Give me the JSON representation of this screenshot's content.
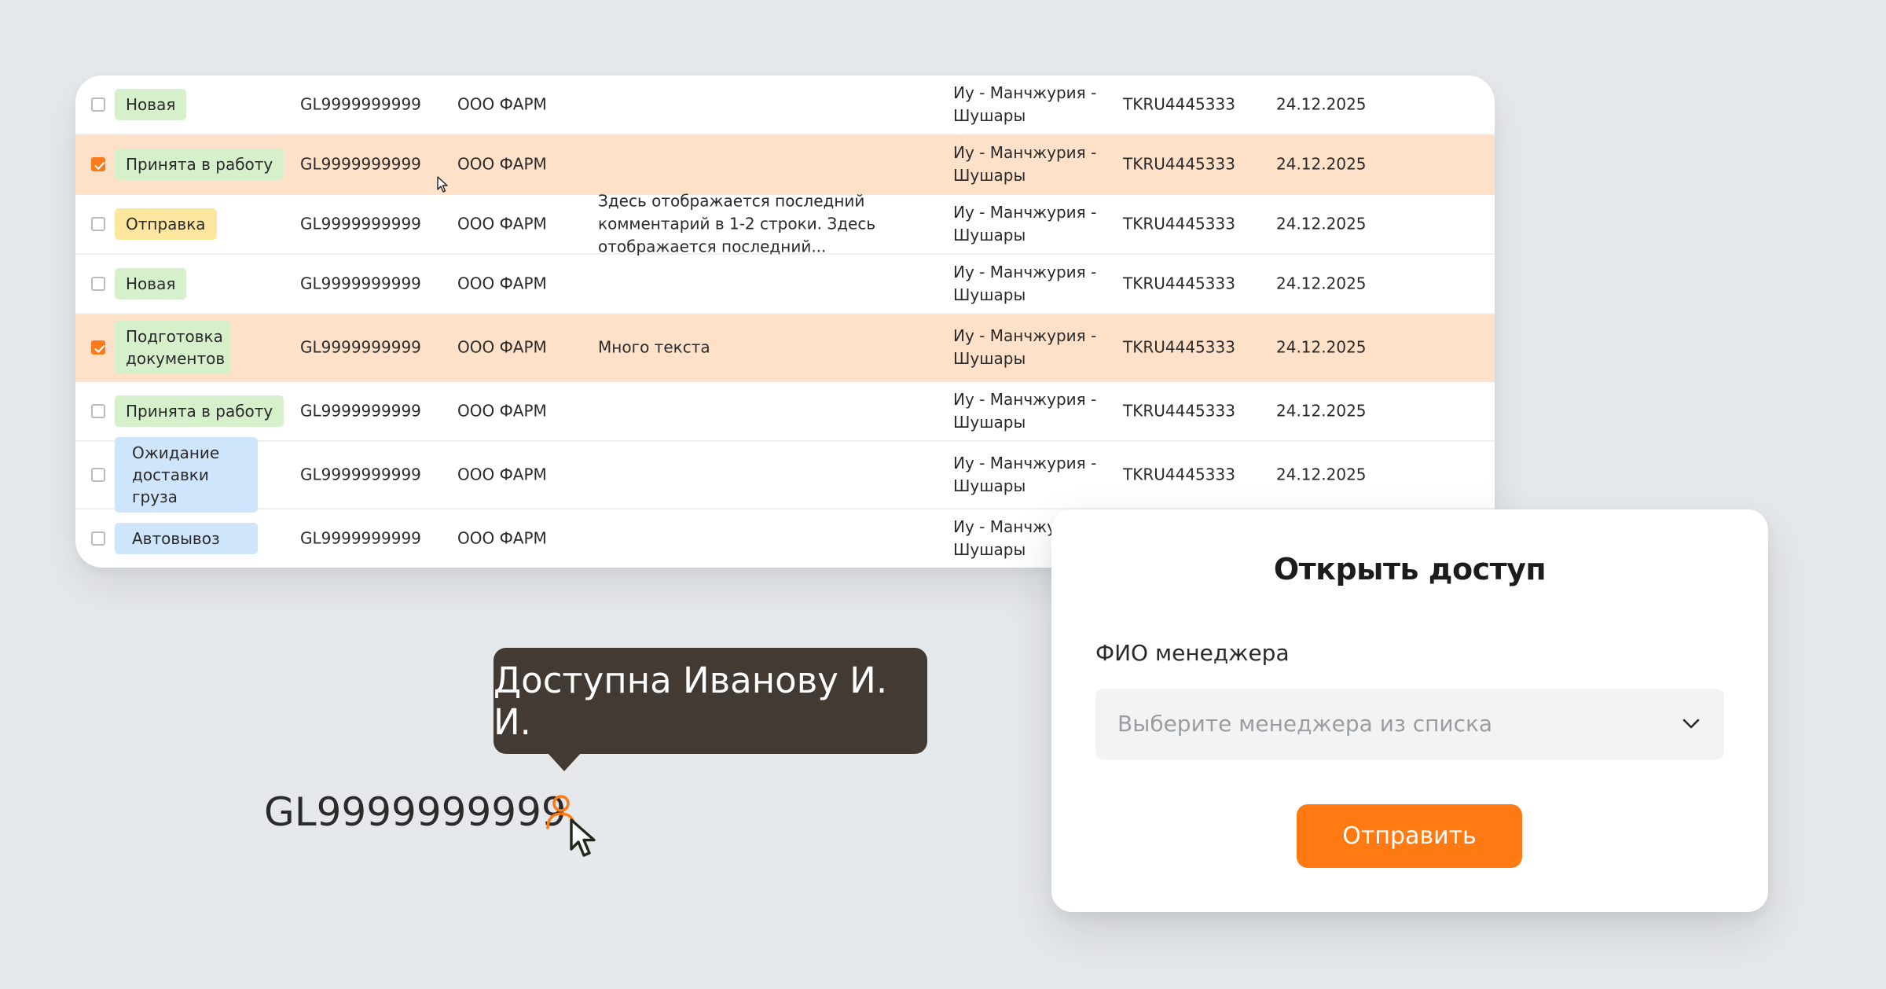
{
  "table": {
    "rows": [
      {
        "checked": false,
        "status": "Новая",
        "status_color": "#d7f0cc",
        "id": "GL9999999999",
        "org": "ООО ФАРМ",
        "comment": "",
        "route": "Иу - Манчжурия - Шушары",
        "container": "TKRU4445333",
        "date": "24.12.2025"
      },
      {
        "checked": true,
        "status": "Принята в работу",
        "status_color": "#d7f0cc",
        "id": "GL9999999999",
        "org": "ООО ФАРМ",
        "comment": "",
        "route": "Иу - Манчжурия - Шушары",
        "container": "TKRU4445333",
        "date": "24.12.2025"
      },
      {
        "checked": false,
        "status": "Отправка",
        "status_color": "#fde6a0",
        "id": "GL9999999999",
        "org": "ООО ФАРМ",
        "comment": "Здесь отображается последний комментарий в 1-2 строки. Здесь отображается последний...",
        "route": "Иу - Манчжурия - Шушары",
        "container": "TKRU4445333",
        "date": "24.12.2025"
      },
      {
        "checked": false,
        "status": "Новая",
        "status_color": "#d7f0cc",
        "id": "GL9999999999",
        "org": "ООО ФАРМ",
        "comment": "",
        "route": "Иу - Манчжурия - Шушары",
        "container": "TKRU4445333",
        "date": "24.12.2025"
      },
      {
        "checked": true,
        "status": "Подготовка документов",
        "status_color": "#d7f0cc",
        "id": "GL9999999999",
        "org": "ООО ФАРМ",
        "comment": "Много текста",
        "route": "Иу - Манчжурия - Шушары",
        "container": "TKRU4445333",
        "date": "24.12.2025"
      },
      {
        "checked": false,
        "status": "Принята в работу",
        "status_color": "#d7f0cc",
        "id": "GL9999999999",
        "org": "ООО ФАРМ",
        "comment": "",
        "route": "Иу - Манчжурия - Шушары",
        "container": "TKRU4445333",
        "date": "24.12.2025"
      },
      {
        "checked": false,
        "status": "Ожидание доставки груза",
        "status_color": "#cfe5fb",
        "id": "GL9999999999",
        "org": "ООО ФАРМ",
        "comment": "",
        "route": "Иу - Манчжурия - Шушары",
        "container": "TKRU4445333",
        "date": "24.12.2025"
      },
      {
        "checked": false,
        "status": "Автовывоз",
        "status_color": "#cfe5fb",
        "id": "GL9999999999",
        "org": "ООО ФАРМ",
        "comment": "",
        "route": "Иу - Манчжурия - Шушары",
        "container": "",
        "date": ""
      }
    ]
  },
  "tooltip": {
    "text": "Доступна Иванову И. И."
  },
  "access_id": {
    "text": "GL9999999999",
    "icon": "person-icon"
  },
  "modal": {
    "title": "Открыть доступ",
    "field_label": "ФИО менеджера",
    "select_placeholder": "Выберите менеджера из списка",
    "submit_label": "Отправить"
  },
  "colors": {
    "accent": "#ff7a12",
    "selected_row": "#fee1c8",
    "tooltip_bg": "#433a34",
    "badge_green": "#d7f0cc",
    "badge_yellow": "#fde6a0",
    "badge_blue": "#cfe5fb"
  }
}
